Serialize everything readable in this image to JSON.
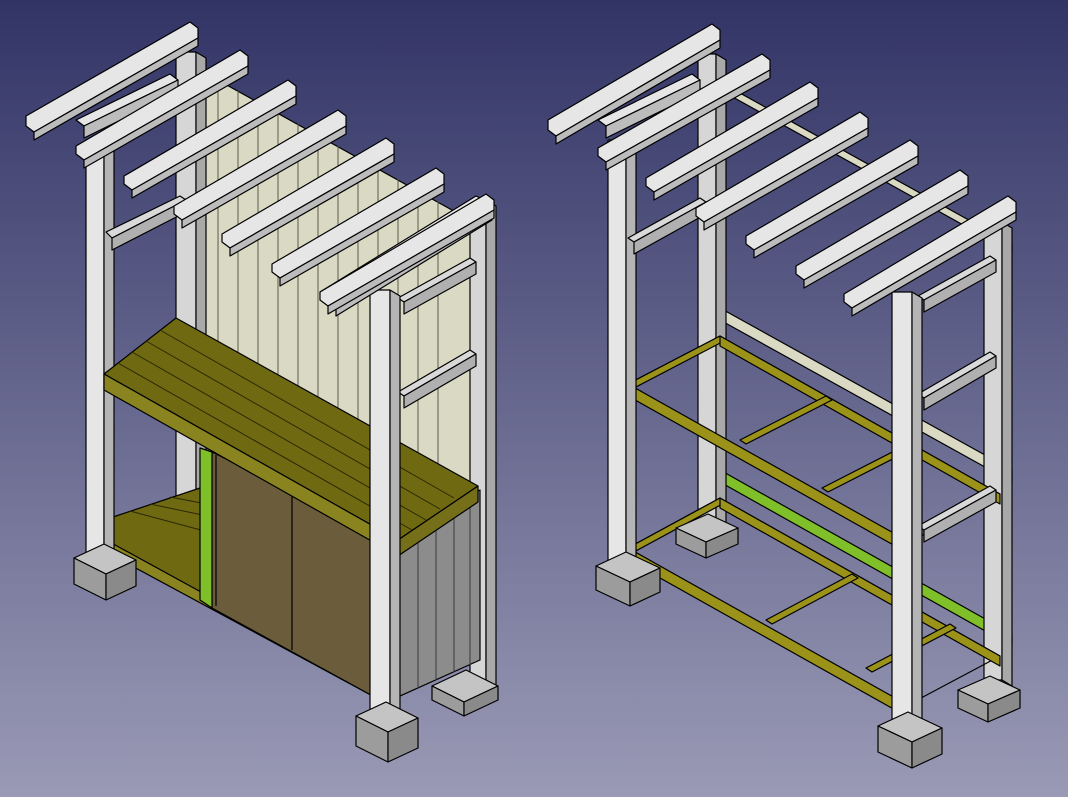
{
  "viewport": {
    "background_top": "#323466",
    "background_bottom": "#9a9ab6"
  },
  "palette": {
    "outline": "#000000",
    "timber_light": "#e6e6e6",
    "timber_mid": "#c9c9c9",
    "timber_dark": "#aaaaaa",
    "siding_face": "#d9d9c4",
    "siding_shadow": "#c4c4ac",
    "olive_top": "#6f6a12",
    "olive_side": "#8a8420",
    "olive_frame": "#9b921a",
    "green_highlight": "#7fbf2a",
    "door_brown": "#6b5d3b",
    "footing_top": "#bdbdbd",
    "footing_side": "#8f8f8f",
    "gray_panel": "#8c8c8c"
  },
  "models": [
    {
      "name": "shed-with-siding-and-doors",
      "variant": "clad"
    },
    {
      "name": "shed-frame-only",
      "variant": "frame"
    }
  ]
}
